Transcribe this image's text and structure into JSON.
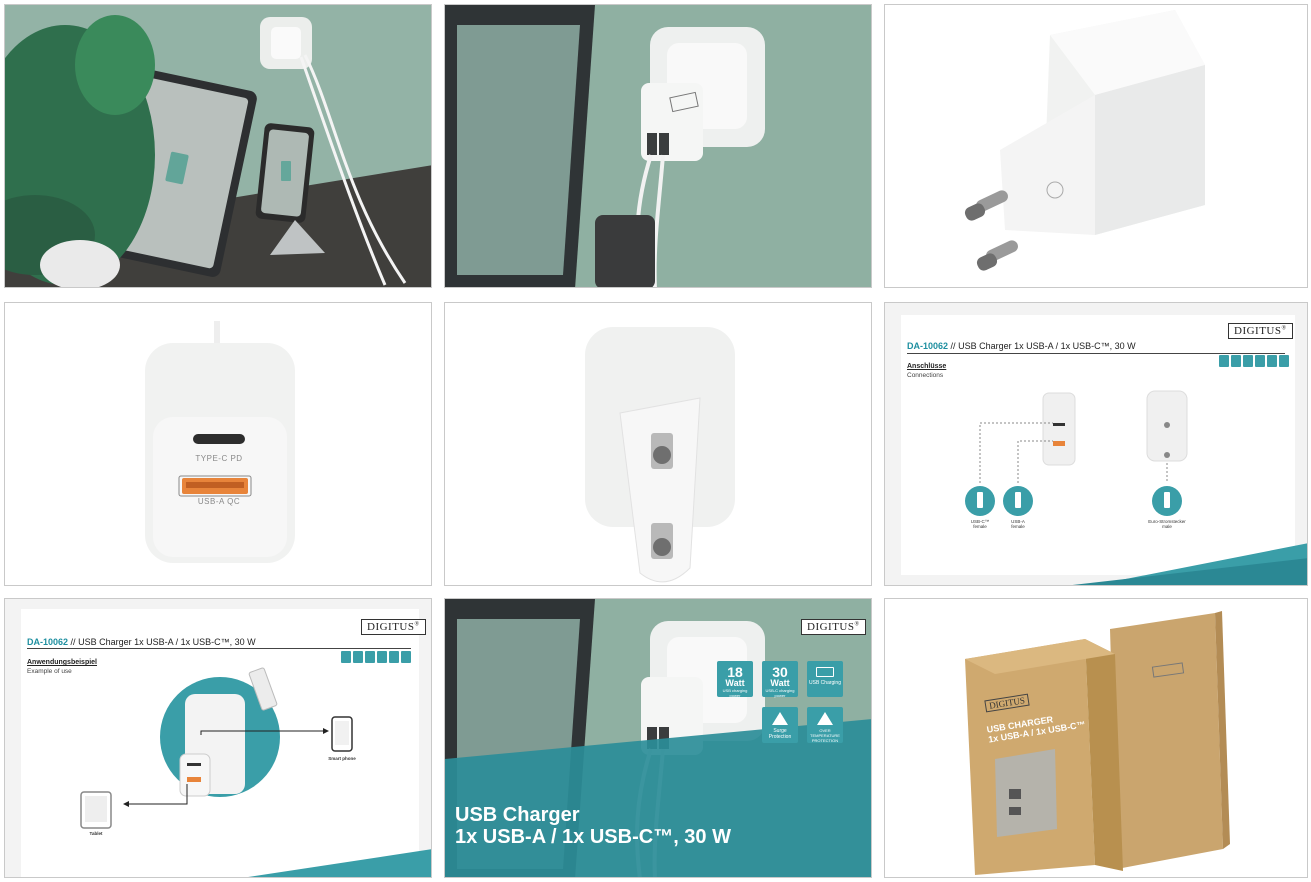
{
  "brand": "DIGITUS",
  "brand_mark": "®",
  "charger_ports": {
    "typec": "TYPE-C PD",
    "usba": "USB-A QC"
  },
  "slide_connections": {
    "model": "DA-10062",
    "sep": "//",
    "title": "USB Charger 1x USB-A / 1x USB-C™, 30 W",
    "section_de": "Anschlüsse",
    "section_en": "Connections",
    "usbc_label": "USB-C™",
    "usbc_sub": "female",
    "usba_label": "USB-A",
    "usba_sub": "female",
    "plug_label": "Euro-Stromstecker",
    "plug_sub": "male"
  },
  "slide_usage": {
    "model": "DA-10062",
    "sep": "//",
    "title": "USB Charger 1x USB-A / 1x USB-C™, 30 W",
    "section_de": "Anwendungsbeispiel",
    "section_en": "Example of use",
    "smartphone": "Smart phone",
    "tablet": "Tablet"
  },
  "features": {
    "f18_num": "18",
    "f18_unit": "Watt",
    "f18_sub": "USB charging power",
    "f30_num": "30",
    "f30_unit": "Watt",
    "f30_sub": "USB-C charging power",
    "usb_charging": "USB Charging",
    "surge": "Surge Protection",
    "overtemp": "OVER TEMPERATURE PROTECTION"
  },
  "headline": {
    "line1": "USB Charger",
    "line2": "1x USB-A / 1x USB-C™, 30 W"
  },
  "box": {
    "brand": "DIGITUS",
    "line1": "USB CHARGER",
    "line2": "1x USB-A / 1x USB-C™"
  },
  "colors": {
    "teal": "#3a9ea8",
    "wall_green": "#8fb0a2",
    "kraft": "#c9a46c"
  }
}
